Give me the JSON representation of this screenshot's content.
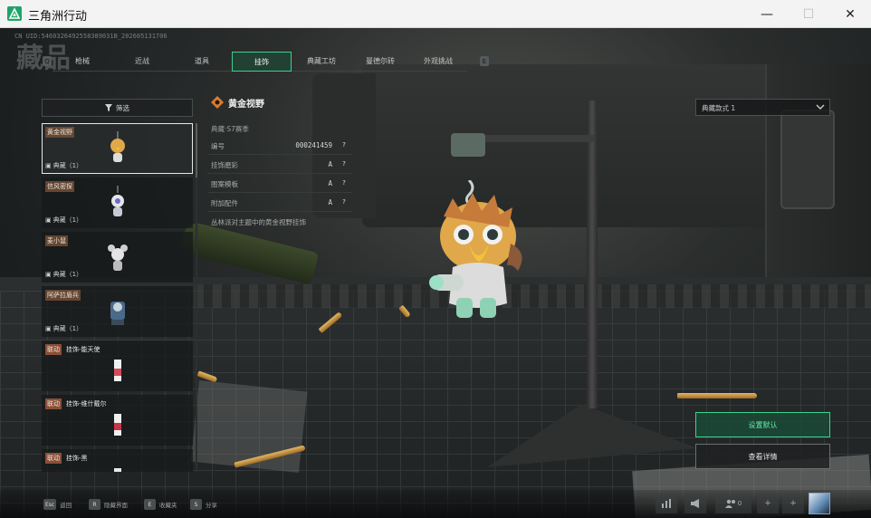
{
  "window": {
    "title": "三角洲行动",
    "minimize": "—",
    "maximize": "☐",
    "close": "✕"
  },
  "uid": "CN UID:5460326492558389031B_202605131706",
  "ghost_title": "藏品",
  "tabs": [
    {
      "label": "枪械",
      "active": false
    },
    {
      "label": "近战",
      "active": false
    },
    {
      "label": "道具",
      "active": false
    },
    {
      "label": "挂饰",
      "active": true
    },
    {
      "label": "典藏工坊",
      "active": false
    },
    {
      "label": "曼德尔砖",
      "active": false
    },
    {
      "label": "外观挑战",
      "active": false
    }
  ],
  "tab_keys": {
    "left": "Q",
    "right": "E"
  },
  "filter": {
    "label": "筛选"
  },
  "list": [
    {
      "name": "黄金视野",
      "tag": "典藏（1）",
      "selected": true,
      "linked": false
    },
    {
      "name": "信风密探",
      "tag": "典藏（1）",
      "selected": false,
      "linked": false
    },
    {
      "name": "麦小鼠",
      "tag": "典藏（1）",
      "selected": false,
      "linked": false
    },
    {
      "name": "阿萨拉盾兵",
      "tag": "典藏（1）",
      "selected": false,
      "linked": false
    },
    {
      "link_tag": "联动",
      "name": "挂饰-能天使",
      "linked": true
    },
    {
      "link_tag": "联动",
      "name": "挂饰-维什戴尔",
      "linked": true
    },
    {
      "link_tag": "联动",
      "name": "挂饰-黑",
      "linked": true
    }
  ],
  "detail": {
    "title": "黄金视野",
    "season": "典藏·S7赛季",
    "attrs": [
      {
        "label": "编号",
        "value": "000241459",
        "q": "?"
      },
      {
        "label": "挂饰磨彩",
        "value": "A",
        "q": "?"
      },
      {
        "label": "图案模板",
        "value": "A",
        "q": "?"
      },
      {
        "label": "附加配件",
        "value": "A",
        "q": "?"
      }
    ],
    "description": "丛林派对主题中的黄金视野挂饰"
  },
  "style_dropdown": {
    "value": "典藏款式 1"
  },
  "buttons": {
    "set_default": "设置默认",
    "view_detail": "查看详情"
  },
  "bottom_hints": [
    {
      "key": "Esc",
      "label": "返回"
    },
    {
      "key": "R",
      "label": "隐藏界面"
    },
    {
      "key": "E",
      "label": "收藏夹"
    },
    {
      "key": "S",
      "label": "分享"
    }
  ],
  "bottom_right": {
    "friends_count": "0",
    "plus1": "+",
    "plus2": "+"
  },
  "colors": {
    "accent": "#3cd08e",
    "link_tag": "#8a4f38",
    "detail_icon": "#e07a2c"
  }
}
